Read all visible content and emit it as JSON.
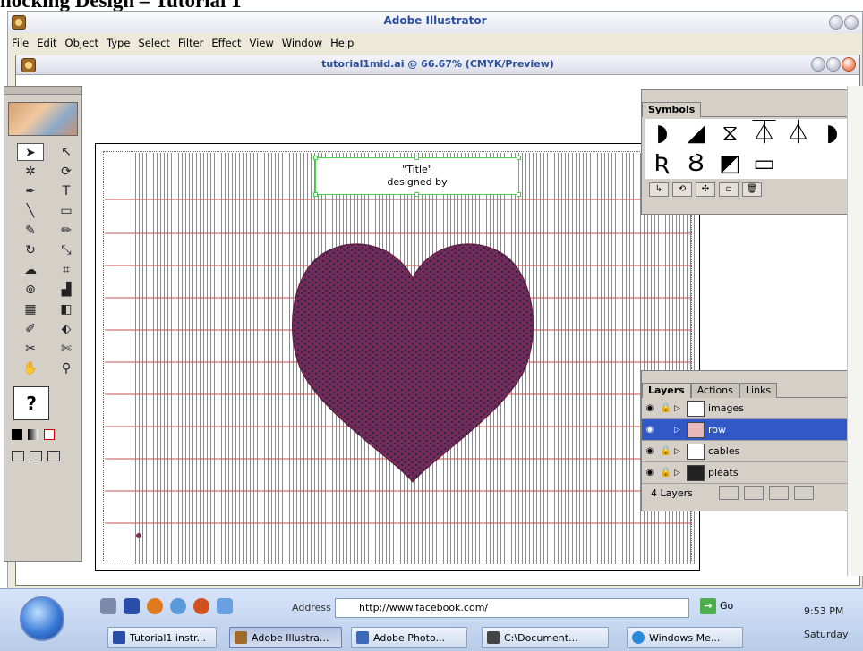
{
  "heading": "nocking Design – Tutorial 1",
  "app": {
    "title": "Adobe Illustrator",
    "menu": [
      "File",
      "Edit",
      "Object",
      "Type",
      "Select",
      "Filter",
      "Effect",
      "View",
      "Window",
      "Help"
    ]
  },
  "document": {
    "title": "tutorial1mid.ai @ 66.67% (CMYK/Preview)",
    "textbox_line1": "\"Title\"",
    "textbox_line2": "designed by"
  },
  "colors": {
    "heart": "#7b2a55",
    "row_line": "#c0504d",
    "stripe": "#8a8a8a",
    "selection": "#4bd04b",
    "layer_selected": "#3158c4"
  },
  "symbols_panel": {
    "tab": "Symbols",
    "symbols": [
      "◗",
      "◢",
      "⧖",
      "⏄",
      "⏃",
      "◗",
      "Ʀ",
      "Ȣ",
      "◩",
      "▭"
    ]
  },
  "layers_panel": {
    "tabs": [
      "Layers",
      "Actions",
      "Links"
    ],
    "layers": [
      {
        "name": "images"
      },
      {
        "name": "row"
      },
      {
        "name": "cables"
      },
      {
        "name": "pleats"
      }
    ],
    "footer": "4 Layers"
  },
  "taskbar": {
    "address_label": "Address",
    "address_value": "http://www.facebook.com/",
    "go_label": "Go",
    "clock": "9:53 PM",
    "day": "Saturday",
    "tasks": [
      "Tutorial1 instr...",
      "Adobe Illustra...",
      "Adobe Photo...",
      "C:\\Document...",
      "Windows Me..."
    ]
  }
}
